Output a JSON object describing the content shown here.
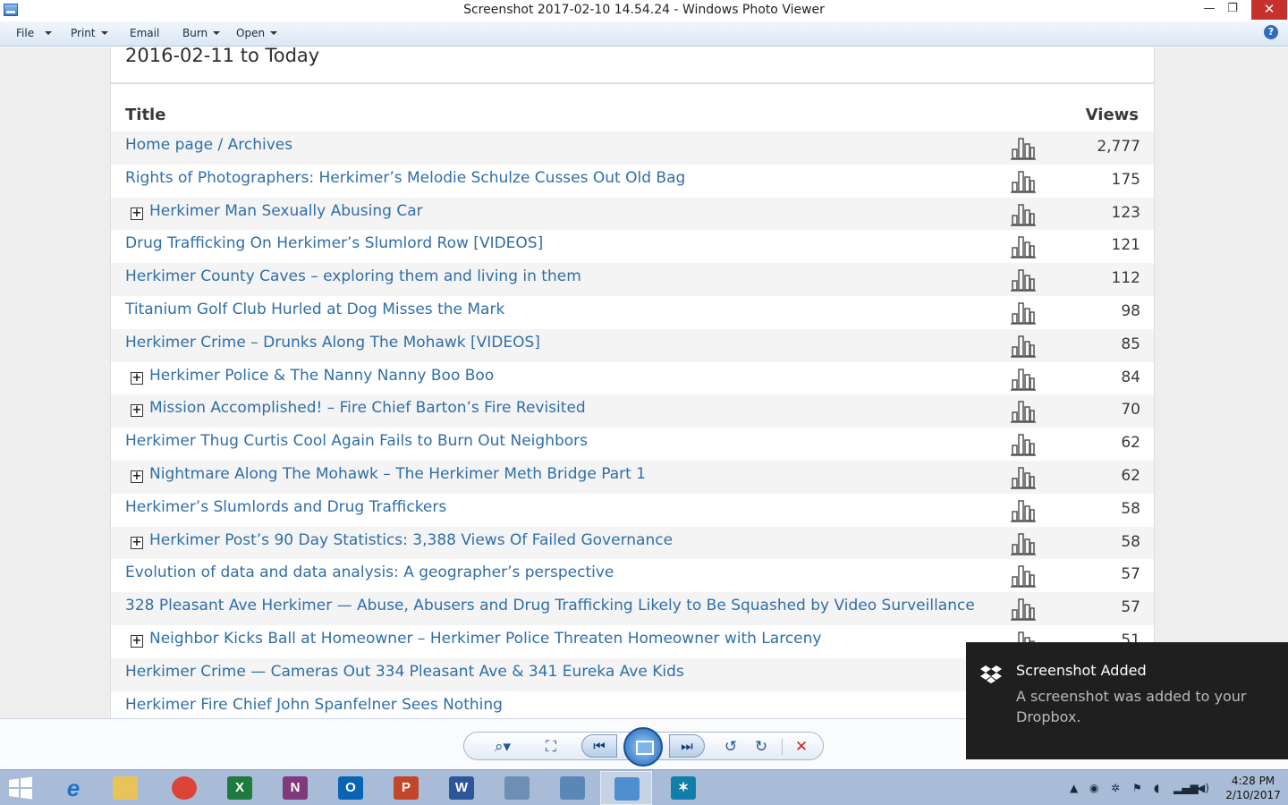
{
  "window": {
    "title": "Screenshot 2017-02-10 14.54.24 - Windows Photo Viewer",
    "minimize_glyph": "—",
    "maximize_glyph": "❐",
    "close_glyph": "✕"
  },
  "menu": {
    "file": "File",
    "print": "Print",
    "email": "Email",
    "burn": "Burn",
    "open": "Open",
    "help_glyph": "?"
  },
  "page": {
    "range_title": "2016-02-11 to Today",
    "col_title": "Title",
    "col_views": "Views",
    "expand_glyph": "+",
    "rows": [
      {
        "title": "Home page / Archives",
        "views": "2,777",
        "expandable": false
      },
      {
        "title": "Rights of Photographers: Herkimer’s Melodie Schulze Cusses Out Old Bag",
        "views": "175",
        "expandable": false
      },
      {
        "title": "Herkimer Man Sexually Abusing Car",
        "views": "123",
        "expandable": true
      },
      {
        "title": "Drug Trafficking On Herkimer’s Slumlord Row [VIDEOS]",
        "views": "121",
        "expandable": false
      },
      {
        "title": "Herkimer County Caves – exploring them and living in them",
        "views": "112",
        "expandable": false
      },
      {
        "title": "Titanium Golf Club Hurled at Dog Misses the Mark",
        "views": "98",
        "expandable": false
      },
      {
        "title": "Herkimer Crime – Drunks Along The Mohawk [VIDEOS]",
        "views": "85",
        "expandable": false
      },
      {
        "title": "Herkimer Police & The Nanny Nanny Boo Boo",
        "views": "84",
        "expandable": true
      },
      {
        "title": "Mission Accomplished! – Fire Chief Barton’s Fire Revisited",
        "views": "70",
        "expandable": true
      },
      {
        "title": "Herkimer Thug Curtis Cool Again Fails to Burn Out Neighbors",
        "views": "62",
        "expandable": false
      },
      {
        "title": "Nightmare Along The Mohawk – The Herkimer Meth Bridge Part 1",
        "views": "62",
        "expandable": true
      },
      {
        "title": "Herkimer’s Slumlords and Drug Traffickers",
        "views": "58",
        "expandable": false
      },
      {
        "title": "Herkimer Post’s 90 Day Statistics: 3,388 Views Of Failed Governance",
        "views": "58",
        "expandable": true
      },
      {
        "title": "Evolution of data and data analysis: A geographer’s perspective",
        "views": "57",
        "expandable": false
      },
      {
        "title": "328 Pleasant Ave Herkimer — Abuse, Abusers and Drug Trafficking Likely to Be Squashed by Video Surveillance",
        "views": "57",
        "expandable": false
      },
      {
        "title": "Neighbor Kicks Ball at Homeowner – Herkimer Police Threaten Homeowner with Larceny",
        "views": "51",
        "expandable": true
      },
      {
        "title": "Herkimer Crime — Cameras Out 334 Pleasant Ave & 341 Eureka Ave Kids",
        "views": "",
        "expandable": false
      },
      {
        "title": "Herkimer Fire Chief John Spanfelner Sees Nothing",
        "views": "",
        "expandable": false
      }
    ]
  },
  "controls": {
    "zoom_glyph": "⌕▾",
    "fit_glyph": "⛶",
    "prev_glyph": "⏮",
    "next_glyph": "⏭",
    "rotate_ccw_glyph": "↺",
    "rotate_cw_glyph": "↻",
    "delete_glyph": "✕"
  },
  "toast": {
    "title": "Screenshot Added",
    "body": "A screenshot was added to your Dropbox."
  },
  "taskbar": {
    "apps": [
      {
        "name": "internet-explorer",
        "glyph": "e",
        "color": "#1e73c8"
      },
      {
        "name": "file-explorer",
        "glyph": "",
        "color": "#e8c35a"
      },
      {
        "name": "chrome",
        "glyph": "",
        "color": "#db4437"
      },
      {
        "name": "excel",
        "glyph": "X",
        "color": "#1f7a3d"
      },
      {
        "name": "onenote",
        "glyph": "N",
        "color": "#80397b"
      },
      {
        "name": "outlook",
        "glyph": "O",
        "color": "#0a64b4"
      },
      {
        "name": "powerpoint",
        "glyph": "P",
        "color": "#c4462a"
      },
      {
        "name": "word",
        "glyph": "W",
        "color": "#2b579a"
      },
      {
        "name": "app-9",
        "glyph": "",
        "color": "#6d8fb3"
      },
      {
        "name": "control-panel",
        "glyph": "",
        "color": "#5b86b8"
      },
      {
        "name": "photo-viewer",
        "glyph": "",
        "color": "#4f8fd0"
      },
      {
        "name": "photo-app",
        "glyph": "✶",
        "color": "#0f7ea8"
      }
    ],
    "clock_time": "4:28 PM",
    "clock_date": "2/10/2017",
    "tray_glyphs": [
      "▲",
      "◉",
      "✲",
      "⚑",
      "◖",
      "▂▄▆",
      "◀)"
    ]
  }
}
